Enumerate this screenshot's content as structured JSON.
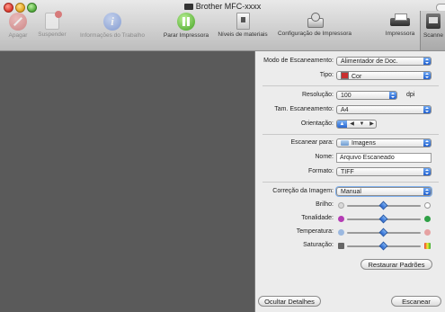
{
  "window": {
    "title": "Brother MFC-xxxx"
  },
  "toolbar": {
    "items": [
      {
        "label": "Apagar",
        "icon": "stop-icon",
        "enabled": false
      },
      {
        "label": "Suspender",
        "icon": "suspend-icon",
        "enabled": false
      },
      {
        "label": "Informações do Trabalho",
        "icon": "info-icon",
        "enabled": false
      },
      {
        "label": "Parar Impressora",
        "icon": "pause-icon",
        "enabled": true
      },
      {
        "label": "Níveis de materiais",
        "icon": "supplies-icon",
        "enabled": true
      },
      {
        "label": "Configuração de Impressora",
        "icon": "printer-setup-icon",
        "enabled": true
      },
      {
        "label": "Impressora",
        "icon": "printer-icon",
        "enabled": true
      },
      {
        "label": "Scanne",
        "icon": "scanner-icon",
        "enabled": true,
        "selected": true
      }
    ]
  },
  "settings": {
    "scan_mode": {
      "label": "Modo de Escaneamento:",
      "value": "Alimentador de Doc."
    },
    "kind": {
      "label": "Tipo:",
      "value": "Cor"
    },
    "resolution": {
      "label": "Resolução:",
      "value": "100",
      "unit": "dpi"
    },
    "scan_size": {
      "label": "Tam. Escaneamento:",
      "value": "A4"
    },
    "orientation": {
      "label": "Orientação:"
    },
    "scan_to": {
      "label": "Escanear para:",
      "value": "Imagens"
    },
    "name": {
      "label": "Nome:",
      "value": "Arquivo Escaneado"
    },
    "format": {
      "label": "Formato:",
      "value": "TIFF"
    },
    "correction": {
      "label": "Correção da Imagem:",
      "value": "Manual"
    },
    "sliders": [
      {
        "label": "Brilho:",
        "level": 0.5
      },
      {
        "label": "Tonalidade:",
        "level": 0.5
      },
      {
        "label": "Temperatura:",
        "level": 0.5
      },
      {
        "label": "Saturação:",
        "level": 0.5
      }
    ],
    "restore_label": "Restaurar Padrões"
  },
  "footer": {
    "hide_details_label": "Ocultar Detalhes",
    "scan_label": "Escanear"
  }
}
